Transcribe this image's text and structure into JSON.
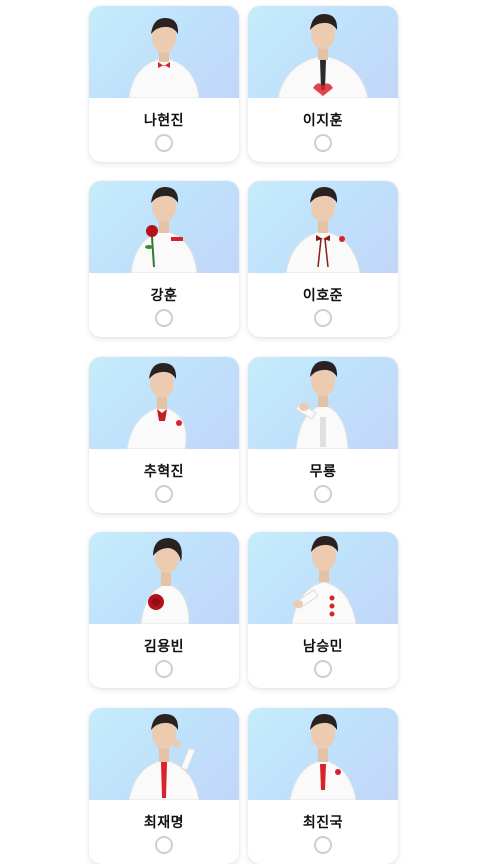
{
  "candidates": [
    {
      "name": "나현진",
      "selected": false
    },
    {
      "name": "이지훈",
      "selected": false
    },
    {
      "name": "강훈",
      "selected": false
    },
    {
      "name": "이호준",
      "selected": false
    },
    {
      "name": "추혁진",
      "selected": false
    },
    {
      "name": "무룡",
      "selected": false
    },
    {
      "name": "김용빈",
      "selected": false
    },
    {
      "name": "남승민",
      "selected": false
    },
    {
      "name": "최재명",
      "selected": false
    },
    {
      "name": "최진국",
      "selected": false
    }
  ],
  "colors": {
    "photo_gradient_start": "#c6ecfb",
    "photo_gradient_end": "#c3d6f8",
    "radio_border": "#cfcfcf",
    "accent_red": "#d8232a"
  }
}
